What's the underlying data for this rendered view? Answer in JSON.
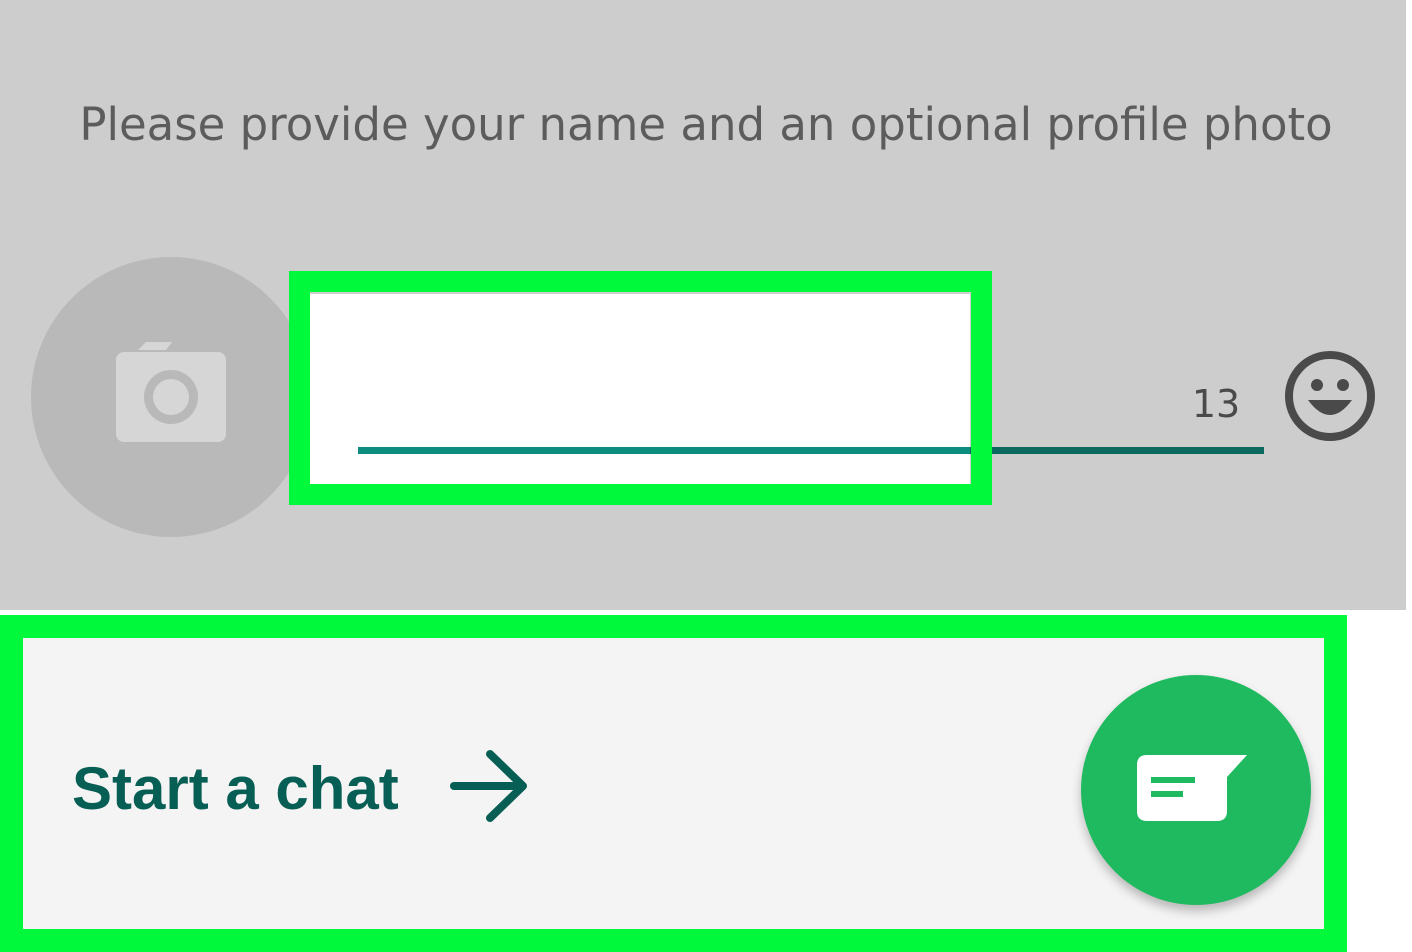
{
  "profile": {
    "prompt": "Please provide your name and an optional profile photo",
    "name_value": "",
    "char_count": "13",
    "avatar_icon": "camera-icon",
    "emoji_icon": "emoji-icon"
  },
  "action": {
    "label": "Start a chat",
    "arrow_icon": "arrow-right-icon",
    "fab_icon": "chat-icon"
  },
  "colors": {
    "highlight": "#00f93b",
    "brand_dark": "#075e54",
    "underline": "#0b6a60",
    "fab": "#1fba5f",
    "panel_gray": "#cdcdcd"
  }
}
